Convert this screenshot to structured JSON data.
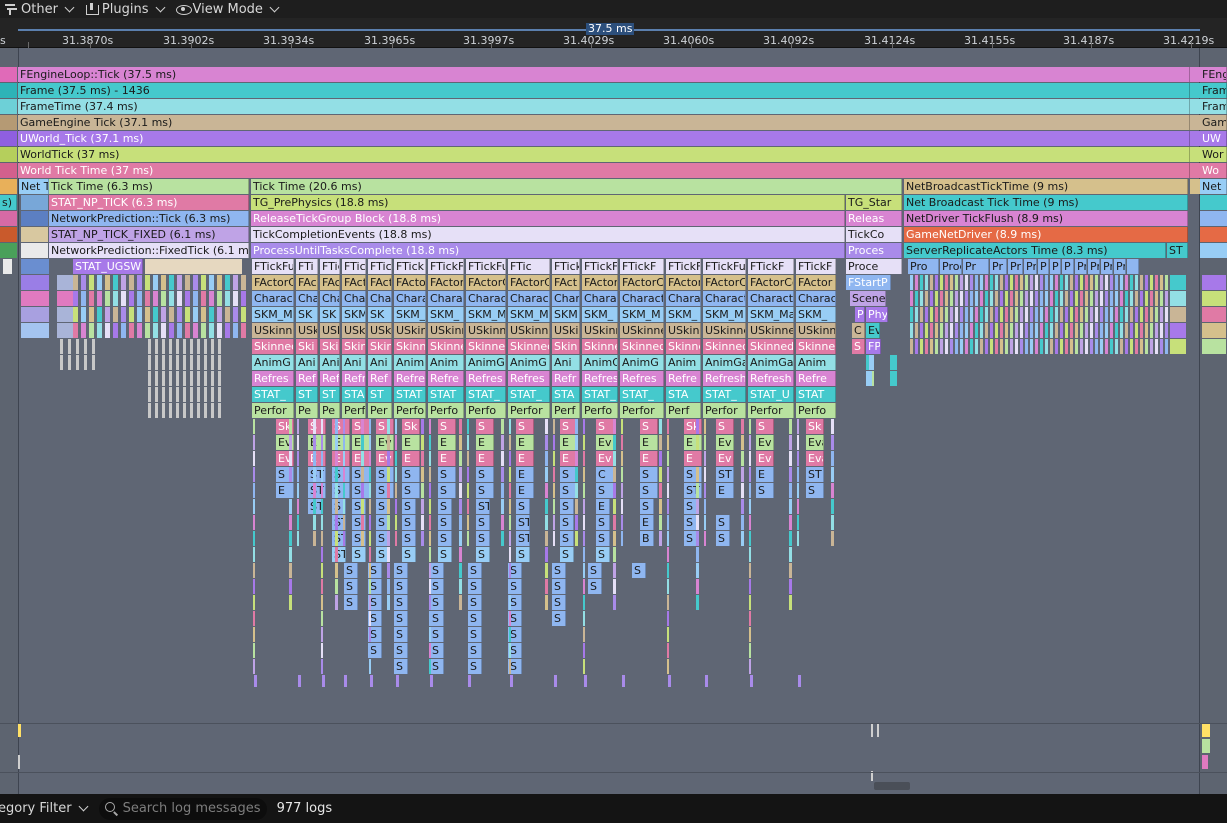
{
  "toolbar": {
    "menus": [
      {
        "label": "Other",
        "icon": "filter-icon"
      },
      {
        "label": "Plugins",
        "icon": "plugins-icon"
      },
      {
        "label": "View Mode",
        "icon": "eye-icon"
      }
    ]
  },
  "ruler": {
    "selection_label": "37.5 ms",
    "ticks": [
      "s",
      "31.3870s",
      "31.3902s",
      "31.3934s",
      "31.3965s",
      "31.3997s",
      "31.4029s",
      "31.4060s",
      "31.4092s",
      "31.4124s",
      "31.4155s",
      "31.4187s",
      "31.4219s"
    ]
  },
  "timing_events": {
    "r0": [
      "FEngineLoop::Tick (37.5 ms)",
      "FEngi"
    ],
    "r1": [
      "Frame (37.5 ms) -  1436",
      "Fram"
    ],
    "r2": [
      "FrameTime (37.4 ms)",
      "Fram"
    ],
    "r3": [
      "GameEngine Tick (37.1 ms)",
      "Gam"
    ],
    "r4": [
      "UWorld_Tick (37.1 ms)",
      "UW"
    ],
    "r5": [
      "WorldTick (37 ms)",
      "Wor"
    ],
    "r6": [
      "World Tick Time (37 ms)",
      "Wo"
    ],
    "r7": [
      "Net T",
      "Tick Time (6.3 ms)",
      "Tick Time (20.6 ms)",
      "NetBroadcastTickTime (9 ms)",
      "Net"
    ],
    "r8": [
      "s)",
      "STAT_NP_TICK (6.3 ms)",
      "TG_PrePhysics (18.8 ms)",
      "TG_Star",
      "Net Broadcast Tick Time (9 ms)"
    ],
    "r9": [
      "NetworkPrediction::Tick (6.3 ms)",
      "ReleaseTickGroup Block (18.8 ms)",
      "Releas",
      "NetDriver TickFlush (8.9 ms)"
    ],
    "r10": [
      "STAT_NP_TICK_FIXED (6.1 ms)",
      "TickCompletionEvents (18.8 ms)",
      "TickCo",
      "GameNetDriver (8.9 ms)"
    ],
    "r11": [
      "NetworkPrediction::FixedTick (6.1 ms)",
      "ProcessUntilTasksComplete (18.8 ms)",
      "Proces",
      "ServerReplicateActors Time (8.3 ms)",
      "ST"
    ],
    "r12": [
      "STAT_UGSW",
      "FTickFu",
      "FTi",
      "FTic",
      "FTic",
      "FTick",
      "FTickF",
      "FTickFu",
      "FTickFu",
      "FTic",
      "FTickF",
      "FTickFu",
      "FTickF",
      "FTickFu",
      "FTickFun",
      "FTickF",
      "FTickF",
      "Proce",
      "Pro",
      "Proc",
      "Pr",
      "Pr",
      "Pr",
      "Pr",
      "P",
      "P",
      "P",
      "Pr",
      "Pr",
      "Pr",
      "Pr"
    ],
    "r13": [
      "FActorC",
      "FAc",
      "FAc",
      "FAct",
      "FAct",
      "FActor",
      "FActor",
      "FActorC",
      "FActorC",
      "FAct",
      "FActor",
      "FActorC",
      "FActor",
      "FActorC",
      "FActorCo",
      "FActor",
      "FStartP"
    ],
    "r14": [
      "Charact",
      "Cha",
      "Cha",
      "Char",
      "Char",
      "Chara",
      "Charac",
      "Charact",
      "Charact",
      "Char",
      "Charac",
      "Charact",
      "Chara",
      "Charact",
      "Characte",
      "Charac",
      "Scene"
    ],
    "r15": [
      "SKM_M",
      "SK",
      "SK",
      "SKM",
      "SK",
      "SKM_",
      "SKM_",
      "SKM_M",
      "SKM_M",
      "SKM",
      "SKM_",
      "SKM_M",
      "SKM_",
      "SKM_M",
      "SKM_Ma",
      "SKM_",
      "P",
      "Phy"
    ],
    "r16": [
      "USkinne",
      "USk",
      "USk",
      "USki",
      "USki",
      "USkin",
      "USkinn",
      "USkinne",
      "USkinne",
      "USki",
      "USkinn",
      "USkinne",
      "USkin",
      "USkinne",
      "USkinned",
      "USkinn",
      "C",
      "Ev"
    ],
    "r17": [
      "Skinned",
      "Ski",
      "Ski",
      "Skin",
      "Skin",
      "Skinn",
      "Skinne",
      "Skinned",
      "Skinned",
      "Skin",
      "Skinne",
      "Skinned",
      "Skinne",
      "Skinned",
      "Skinned",
      "Skinne",
      "S",
      "FP"
    ],
    "r18": [
      "AnimG",
      "Ani",
      "Ani",
      "Ani",
      "Ani",
      "Anim",
      "Anim",
      "AnimG",
      "AnimG",
      "Ani",
      "AnimG",
      "AnimG",
      "Anim",
      "AnimGa",
      "AnimGa",
      "Anim"
    ],
    "r19": [
      "Refres",
      "Ref",
      "Ref",
      "Refr",
      "Ref",
      "Refre",
      "Refre",
      "Refres",
      "Refres",
      "Refr",
      "Refres",
      "Refres",
      "Refre",
      "Refresh",
      "Refresh",
      "Refre"
    ],
    "r20": [
      "STAT_",
      "ST",
      "ST",
      "STA",
      "ST",
      "STAT",
      "STAT",
      "STAT_",
      "STAT_",
      "STA",
      "STAT_",
      "STAT_",
      "STA",
      "STAT_",
      "STAT_U",
      "STAT"
    ],
    "r21": [
      "Perfor",
      "Pe",
      "Pe",
      "Perf",
      "Per",
      "Perfo",
      "Perfo",
      "Perfo",
      "Perfor",
      "Perf",
      "Perfo",
      "Perfor",
      "Perf",
      "Perfor",
      "Perfor",
      "Perfo"
    ],
    "r22": [
      "Sk",
      "S",
      "S",
      "S",
      "S",
      "Sk",
      "S",
      "S",
      "S",
      "S",
      "S",
      "S",
      "Sk",
      "S",
      "S",
      "Sk",
      "S",
      "Ske",
      "S",
      "P",
      "S",
      "S",
      "S",
      "S"
    ],
    "r23": [
      "Ev",
      "E",
      "E",
      "E",
      "Ev",
      "E",
      "E",
      "E",
      "E",
      "E",
      "Ev",
      "E",
      "E",
      "Ev",
      "Ev",
      "Eva",
      "E",
      "A",
      "Ev",
      "Ev",
      "E",
      "E"
    ],
    "r24": [
      "Ev",
      "E",
      "E",
      "E",
      "Ev",
      "E",
      "E",
      "E",
      "E",
      "E",
      "Ev",
      "E",
      "E",
      "Ev",
      "Ev",
      "Eva",
      "E",
      "Ev",
      "Ev",
      "E",
      "E"
    ],
    "r25": [
      "ST",
      "S",
      "S",
      "S",
      "S",
      "S",
      "S",
      "E",
      "S",
      "C",
      "S",
      "S",
      "ST",
      "E",
      "ST",
      "S",
      "E",
      "C",
      "S",
      "Ev",
      "S",
      "E",
      "S"
    ],
    "r26": [
      "ST",
      "S",
      "S",
      "S",
      "S",
      "S",
      "S",
      "E",
      "S",
      "S",
      "S",
      "ST",
      "E",
      "S",
      "S",
      "E",
      "S",
      "S",
      "Ev",
      "S",
      "E",
      "S"
    ],
    "r27": [
      "ST",
      "S",
      "S",
      "S",
      "S",
      "S",
      "ST",
      "S",
      "S",
      "E",
      "S",
      "S"
    ],
    "r28": [
      "ST",
      "S",
      "S",
      "S",
      "S",
      "S",
      "ST",
      "S",
      "S",
      "E",
      "S",
      "S"
    ],
    "r29": [
      "ST",
      "S",
      "S",
      "S",
      "S",
      "S",
      "ST",
      "S",
      "S",
      "B",
      "S",
      "S"
    ],
    "r30": [
      "ST",
      "S",
      "S",
      "S",
      "S",
      "S",
      "S",
      "S",
      "S"
    ],
    "r31": [
      "S",
      "S",
      "S",
      "S",
      "S",
      "S",
      "S",
      "S",
      "S"
    ],
    "r32": [
      "S",
      "S",
      "S",
      "S",
      "S",
      "S",
      "S",
      "S"
    ],
    "r33": [
      "S",
      "S",
      "S",
      "S",
      "S",
      "S",
      "S"
    ],
    "r34": [
      "S",
      "S",
      "S",
      "S",
      "S",
      "S"
    ],
    "r35": [
      "S",
      "S",
      "S",
      "S",
      "S"
    ],
    "r36": [
      "S",
      "S",
      "S",
      "S",
      "S"
    ],
    "r37": [
      "S",
      "S",
      "S",
      "S"
    ]
  },
  "colors": {
    "pink": "#d884d2",
    "cyan": "#45c9cc",
    "lightcyan": "#93dfe5",
    "tan": "#c9b596",
    "purple": "#a779e9",
    "yellowgreen": "#c7e07a",
    "rose": "#e07aa5",
    "sand": "#d5c08c",
    "lightgreen": "#b8e2a0",
    "lilac": "#bfa3e6",
    "lavender": "#e6e0f7",
    "violet": "#a98bea",
    "blue": "#8fb6f0",
    "sky": "#98cdf5"
  },
  "logbar": {
    "category_filter": "egory Filter",
    "search_placeholder": "Search log messages",
    "log_count": "977 logs"
  }
}
